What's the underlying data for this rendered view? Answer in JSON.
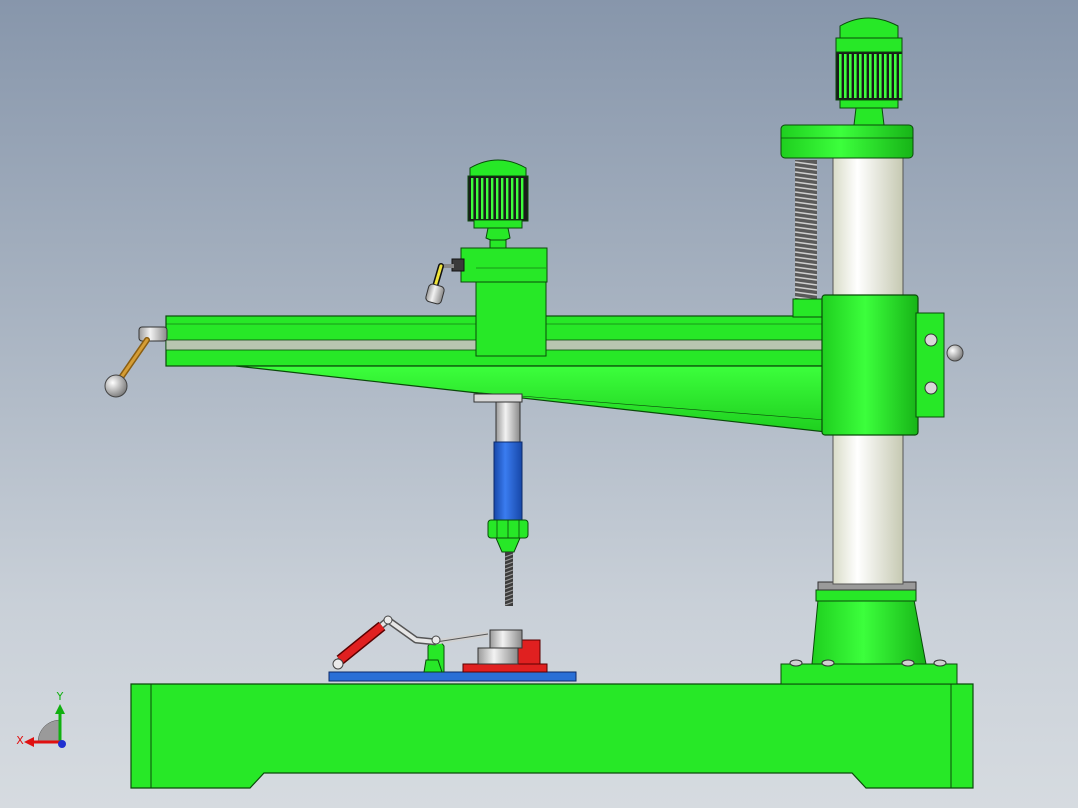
{
  "viewport": {
    "model": "radial-drill-press-assembly",
    "background_top": "#8796ab",
    "background_bottom": "#d6dbe0"
  },
  "colors": {
    "body_green": "#27e827",
    "dark_green": "#14a814",
    "column_white": "#f3f6e2",
    "spindle_blue": "#1f5fd6",
    "clamp_red": "#e02020",
    "table_blue": "#2a6fd6",
    "handle_brown": "#b5862b",
    "steel": "#c9c9c9"
  },
  "triad": {
    "x_label": "X",
    "y_label": "Y",
    "x_color": "#e01010",
    "y_color": "#10b010",
    "z_color": "#2030d0"
  }
}
